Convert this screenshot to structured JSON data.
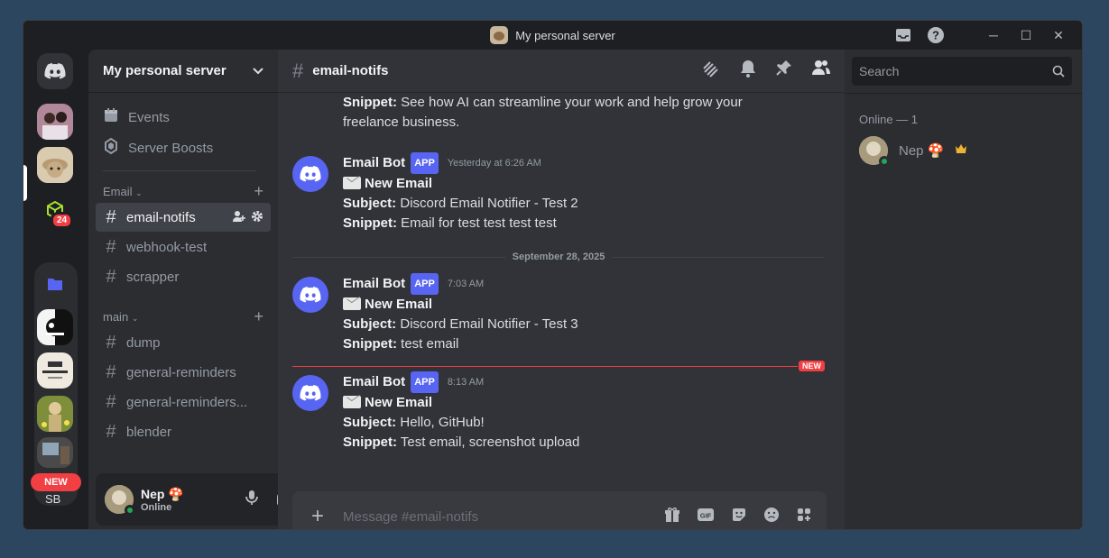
{
  "window": {
    "title": "My personal server"
  },
  "rail": {
    "mention_badge": "24",
    "new_label": "NEW",
    "partial_label": "SB"
  },
  "sidebar": {
    "server_name": "My personal server",
    "items": [
      {
        "label": "Events",
        "icon": "calendar-icon"
      },
      {
        "label": "Server Boosts",
        "icon": "boost-icon"
      }
    ],
    "categories": [
      {
        "name": "Email",
        "channels": [
          "email-notifs",
          "webhook-test",
          "scrapper"
        ]
      },
      {
        "name": "main",
        "channels": [
          "dump",
          "general-reminders",
          "general-reminders...",
          "blender"
        ]
      }
    ]
  },
  "user": {
    "name": "Nep 🍄",
    "status": "Online"
  },
  "channel": {
    "name": "email-notifs"
  },
  "messages": [
    {
      "partial": true,
      "snippet_label": "Snippet:",
      "snippet": "See how AI can streamline your work and help grow your freelance business."
    },
    {
      "author": "Email Bot",
      "tag": "APP",
      "time": "Yesterday at 6:26 AM",
      "title": "New Email",
      "subject_label": "Subject:",
      "subject": "Discord Email Notifier - Test 2",
      "snippet_label": "Snippet:",
      "snippet": "Email for test test test test"
    },
    {
      "author": "Email Bot",
      "tag": "APP",
      "time": "7:03 AM",
      "title": "New Email",
      "subject_label": "Subject:",
      "subject": "Discord Email Notifier - Test 3",
      "snippet_label": "Snippet:",
      "snippet": "test email"
    },
    {
      "author": "Email Bot",
      "tag": "APP",
      "time": "8:13 AM",
      "title": "New Email",
      "subject_label": "Subject:",
      "subject": "Hello, GitHub!",
      "snippet_label": "Snippet:",
      "snippet": "Test email, screenshot upload"
    }
  ],
  "date_separator": "September 28, 2025",
  "new_marker": "NEW",
  "composer": {
    "placeholder": "Message #email-notifs"
  },
  "search": {
    "placeholder": "Search"
  },
  "members": {
    "online_header": "Online — 1",
    "list": [
      {
        "name": "Nep 🍄"
      }
    ]
  },
  "colors": {
    "blurple": "#5865f2",
    "red": "#f23f43",
    "online": "#23a55a"
  }
}
